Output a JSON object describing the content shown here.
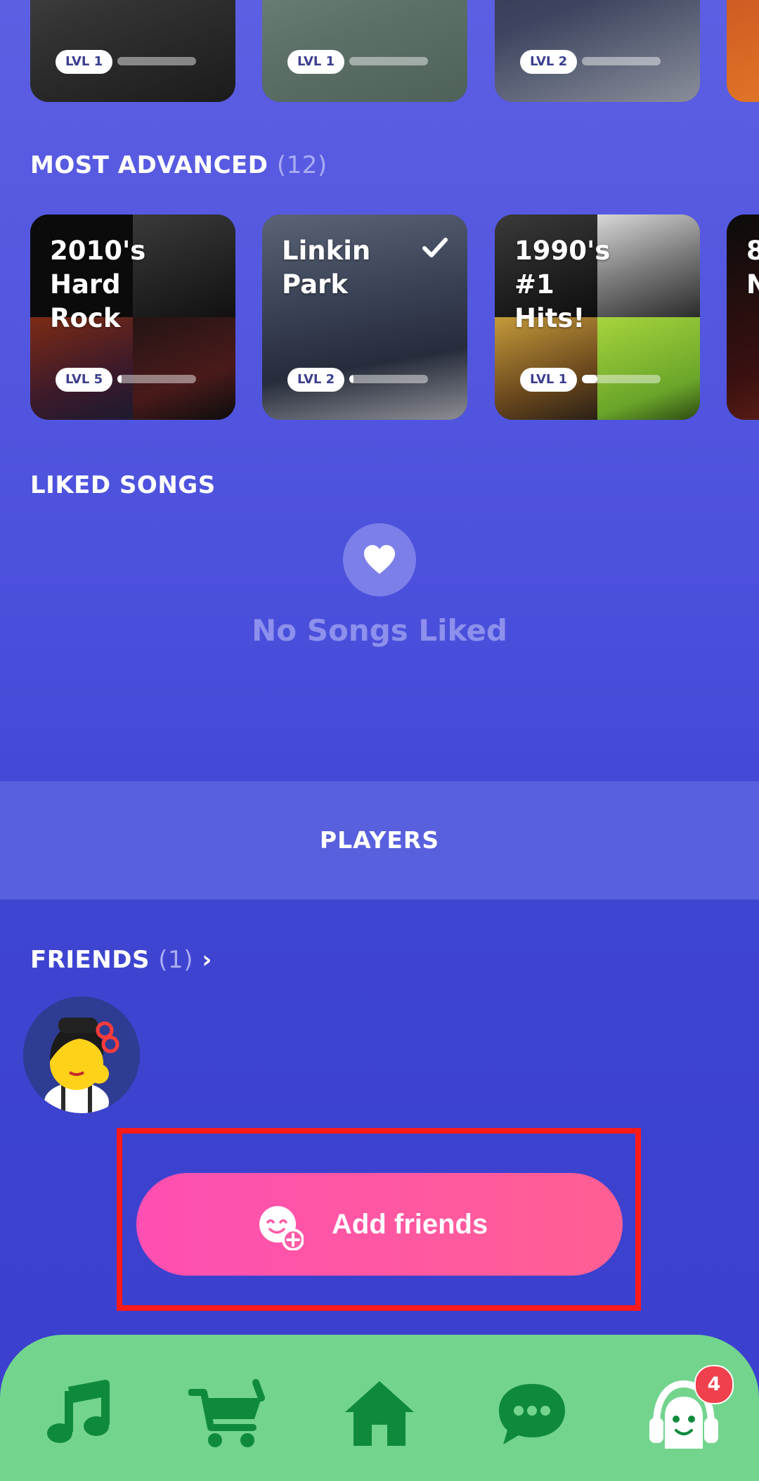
{
  "top_row": {
    "cards": [
      {
        "level": "LVL 1",
        "progress": 0.0
      },
      {
        "level": "LVL 1",
        "progress": 0.0
      },
      {
        "level": "LVL 2",
        "progress": 0.0
      }
    ]
  },
  "most_advanced": {
    "title": "MOST ADVANCED",
    "count": "(12)",
    "cards": [
      {
        "title": "2010's Hard\nRock",
        "level": "LVL 5",
        "progress": 0.05,
        "checked": false
      },
      {
        "title": "Linkin\nPark",
        "level": "LVL 2",
        "progress": 0.05,
        "checked": true
      },
      {
        "title": "1990's #1\nHits!",
        "level": "LVL 1",
        "progress": 0.2,
        "checked": false
      },
      {
        "title": "8\nN",
        "level": "",
        "progress": 0,
        "checked": false
      }
    ]
  },
  "liked_songs": {
    "title": "LIKED SONGS",
    "empty_text": "No Songs Liked"
  },
  "players": {
    "label": "PLAYERS"
  },
  "friends": {
    "title": "FRIENDS",
    "count": "(1)",
    "chevron": "›"
  },
  "add_friends": {
    "label": "Add friends"
  },
  "nav": {
    "items": [
      {
        "icon": "music-note-icon"
      },
      {
        "icon": "shopping-cart-icon"
      },
      {
        "icon": "home-icon"
      },
      {
        "icon": "chat-bubble-icon"
      },
      {
        "icon": "profile-headphones-icon"
      }
    ],
    "badge": "4"
  },
  "colors": {
    "background": "#4a4fdb",
    "accent_pink": "#ff4fb3",
    "nav_green": "#73d48e",
    "icon_green": "#0f8a3c",
    "badge_red": "#f0404d",
    "highlight_red": "#ff1a1a"
  }
}
